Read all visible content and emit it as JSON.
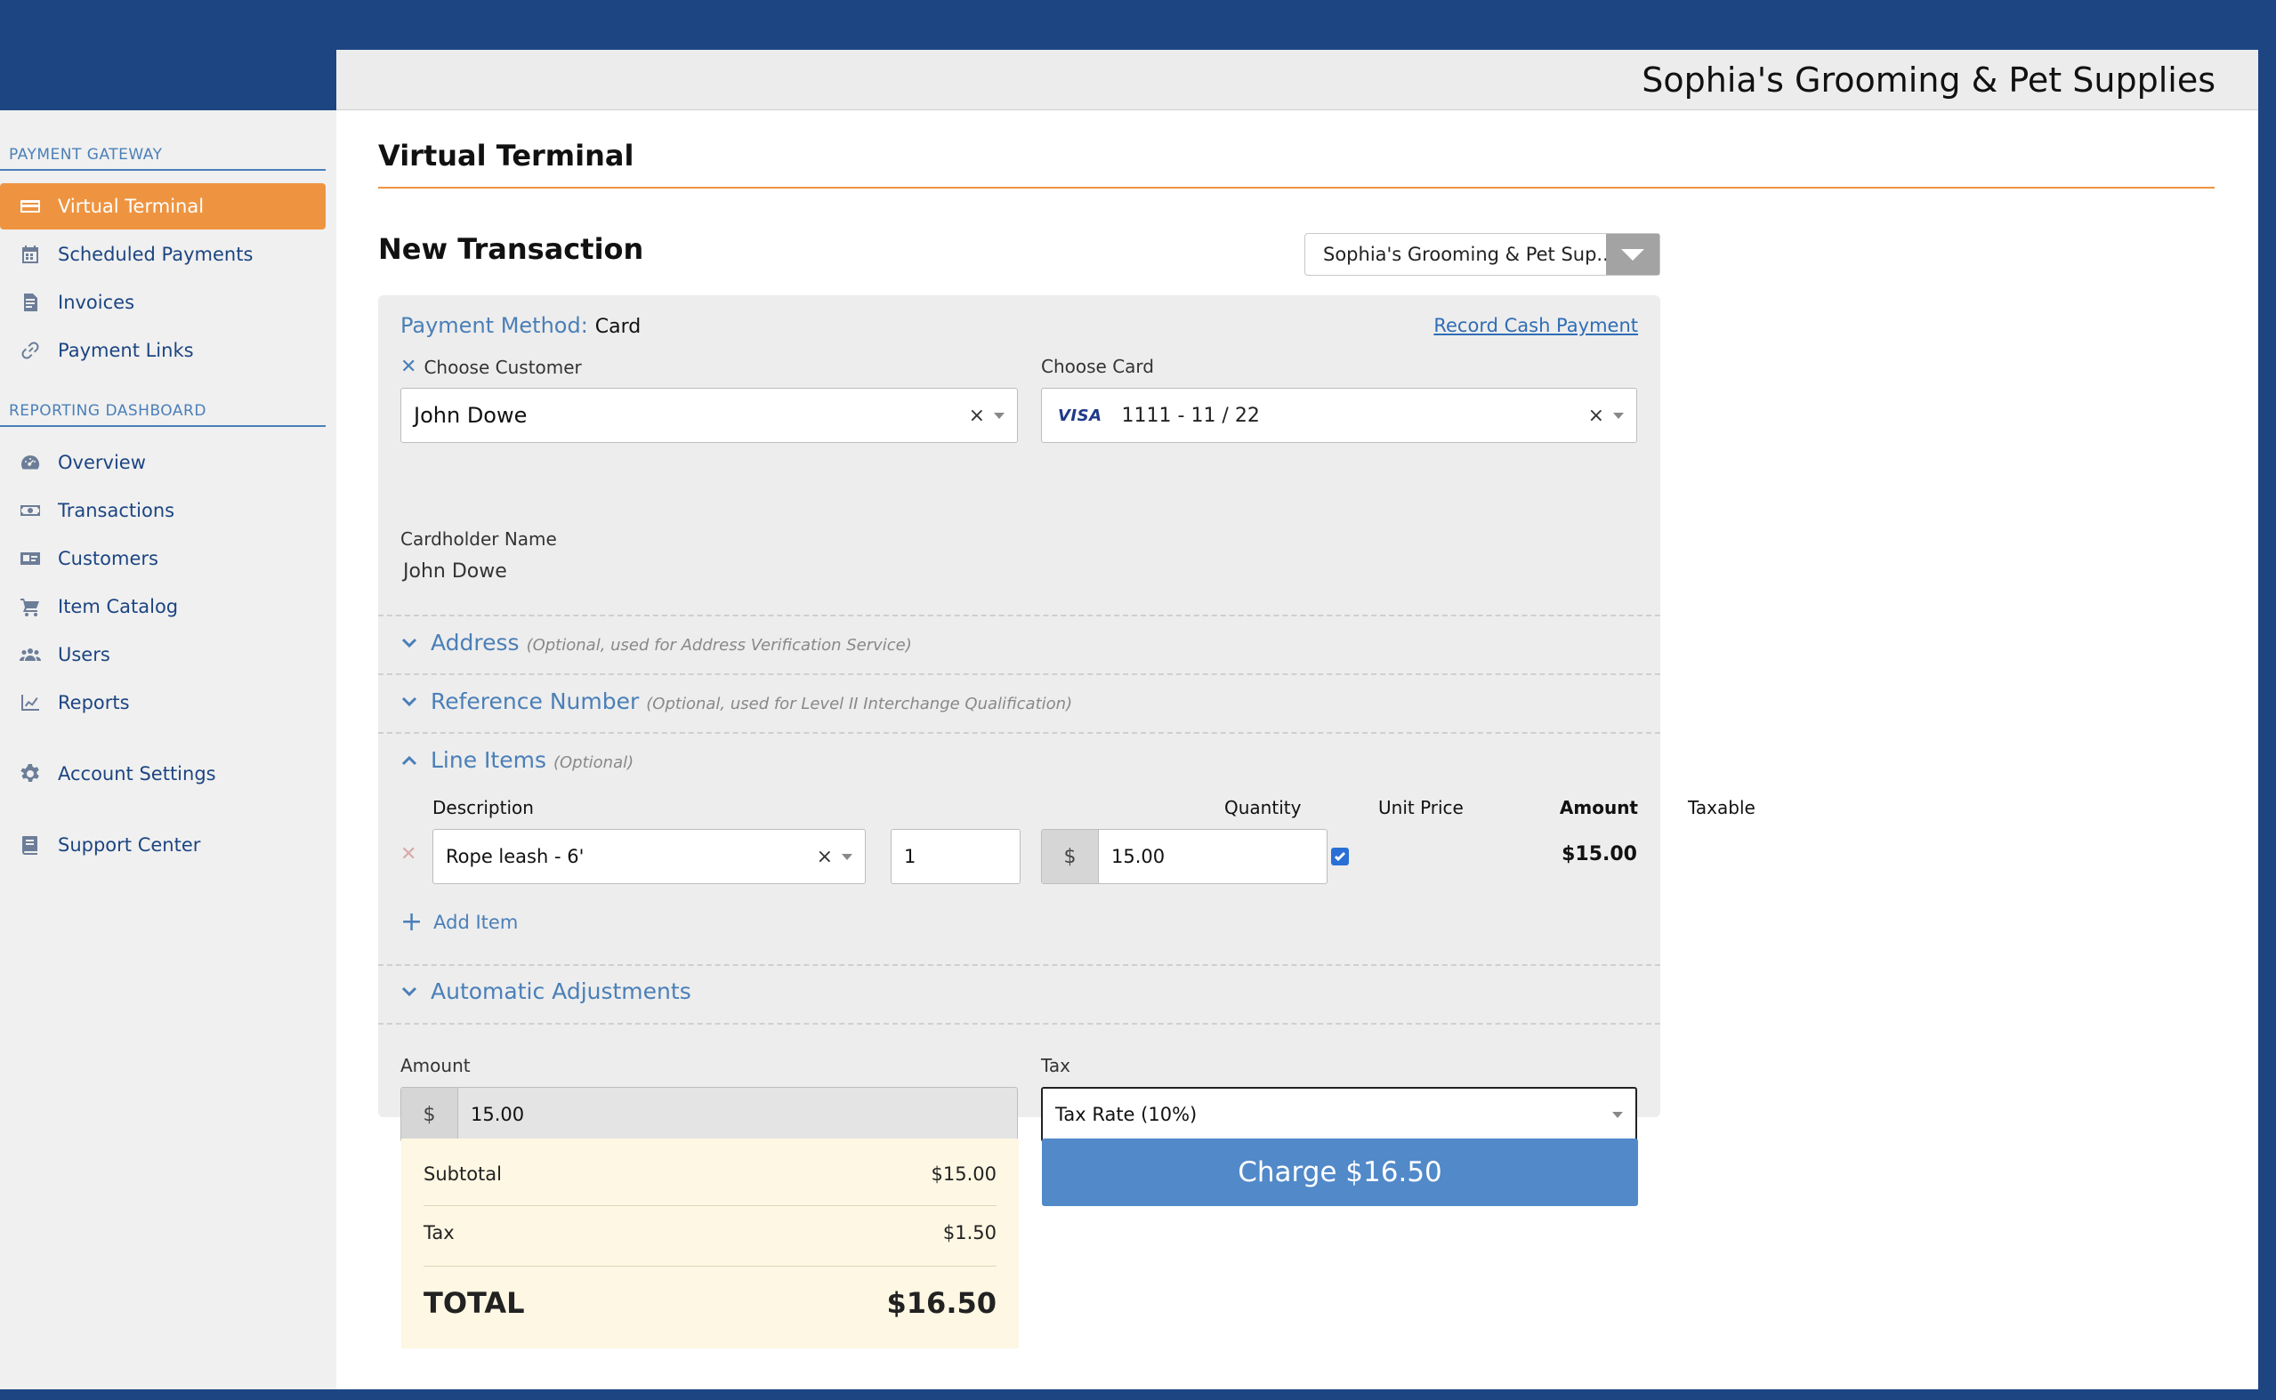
{
  "header": {
    "store_name": "Sophia's Grooming & Pet Supplies"
  },
  "sidebar": {
    "sections": [
      {
        "title": "PAYMENT GATEWAY"
      },
      {
        "title": "REPORTING DASHBOARD"
      }
    ],
    "items": [
      {
        "label": "Virtual Terminal",
        "icon": "credit-card-icon",
        "active": true
      },
      {
        "label": "Scheduled Payments",
        "icon": "calendar-icon"
      },
      {
        "label": "Invoices",
        "icon": "document-icon"
      },
      {
        "label": "Payment Links",
        "icon": "link-icon"
      },
      {
        "label": "Overview",
        "icon": "dashboard-icon"
      },
      {
        "label": "Transactions",
        "icon": "money-icon"
      },
      {
        "label": "Customers",
        "icon": "id-card-icon"
      },
      {
        "label": "Item Catalog",
        "icon": "cart-icon"
      },
      {
        "label": "Users",
        "icon": "users-icon"
      },
      {
        "label": "Reports",
        "icon": "chart-line-icon"
      },
      {
        "label": "Account Settings",
        "icon": "gear-icon"
      },
      {
        "label": "Support Center",
        "icon": "book-icon"
      }
    ]
  },
  "page": {
    "title": "Virtual Terminal",
    "section_title": "New Transaction",
    "merchant_select": "Sophia's Grooming & Pet Sup..."
  },
  "payment": {
    "method_label": "Payment Method:",
    "method_value": "Card",
    "record_cash": "Record Cash Payment",
    "customer_label": "Choose Customer",
    "customer_value": "John Dowe",
    "card_label": "Choose Card",
    "card_brand": "VISA",
    "card_value": "1111  -  11 / 22",
    "cardholder_label": "Cardholder Name",
    "cardholder_value": "John Dowe"
  },
  "sections": {
    "address": {
      "title": "Address",
      "hint": "(Optional, used for Address Verification Service)"
    },
    "reference": {
      "title": "Reference Number",
      "hint": "(Optional, used for Level II Interchange Qualification)"
    },
    "line_items": {
      "title": "Line Items",
      "hint": "(Optional)"
    },
    "adjustments": {
      "title": "Automatic Adjustments"
    }
  },
  "line_items": {
    "headers": {
      "description": "Description",
      "quantity": "Quantity",
      "unit_price": "Unit Price",
      "taxable": "Taxable",
      "amount": "Amount"
    },
    "rows": [
      {
        "description": "Rope leash - 6'",
        "quantity": "1",
        "currency": "$",
        "unit_price": "15.00",
        "taxable": true,
        "amount": "$15.00"
      }
    ],
    "add_label": "Add Item"
  },
  "totals_form": {
    "amount_label": "Amount",
    "currency": "$",
    "amount_value": "15.00",
    "tax_label": "Tax",
    "tax_value": "Tax Rate (10%)"
  },
  "summary": {
    "subtotal_label": "Subtotal",
    "subtotal_value": "$15.00",
    "tax_label": "Tax",
    "tax_value": "$1.50",
    "total_label": "TOTAL",
    "total_value": "$16.50"
  },
  "charge_button": "Charge $16.50",
  "colors": {
    "brand_navy": "#1c4582",
    "accent_orange": "#ee9440",
    "link_blue": "#4a7fb8",
    "button_blue": "#5189c9"
  }
}
